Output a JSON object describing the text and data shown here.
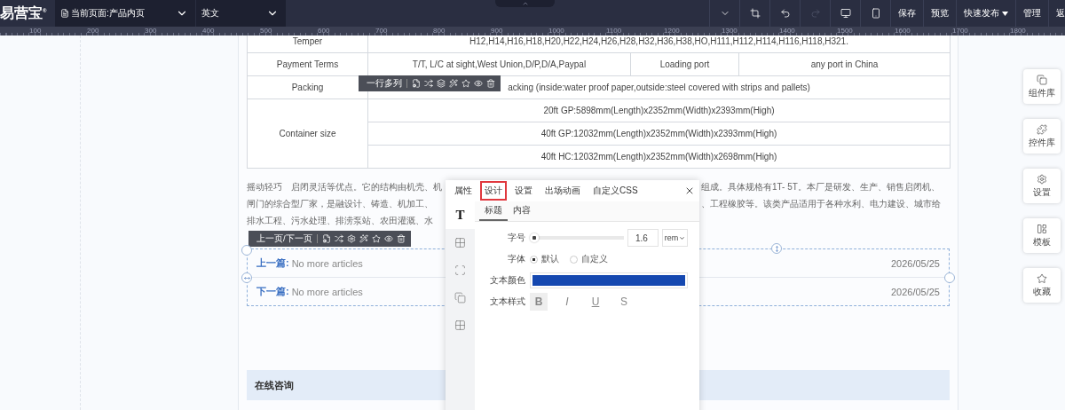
{
  "topbar": {
    "logo": "易营宝$^{®}$",
    "page_select": "当前页面:产品内页",
    "language_select": "英文",
    "tools": [
      {
        "disabled": false
      },
      {
        "disabled": false
      },
      {
        "disabled": false
      },
      {
        "disabled": true
      },
      {
        "disabled": false
      },
      {
        "disabled": false
      }
    ],
    "buttons": [
      {
        "label": "保存",
        "menu": false
      },
      {
        "label": "预览",
        "menu": false
      },
      {
        "label": "快速发布",
        "menu": true
      },
      {
        "label": "管理",
        "menu": false
      },
      {
        "label": "返",
        "menu": false
      }
    ]
  },
  "ruler": {
    "labels": [
      "100",
      "200",
      "300",
      "400",
      "500",
      "600",
      "700",
      "800",
      "900",
      "1000",
      "1100",
      "1200",
      "1300",
      "1400",
      "1500",
      "1600",
      "1700",
      "1800"
    ]
  },
  "spec_table": {
    "rows": [
      {
        "label": {
          "text": "Temper"
        },
        "cells": [
          {
            "text": "H12,H14,H16,H18,H20,H22,H24,H26,H28,H32,H36,H38,HO,H111,H112,H114,H116,H118,H321.",
            "colspan": 3
          }
        ]
      },
      {
        "label": {
          "text": "Payment Terms"
        },
        "cells": [
          {
            "text": "T/T, L/C at sight,West Union,D/P,D/A,Paypal"
          },
          {
            "text": "Loading port"
          },
          {
            "text": "any port in China"
          }
        ]
      },
      {
        "label": {
          "text": "Packing"
        },
        "cells": [
          {
            "text": "acking (inside:water proof paper,outside:steel covered with strips and pallets)",
            "colspan": 3
          }
        ]
      },
      {
        "label": {
          "text": "Container size",
          "rowspan": 3
        },
        "cells": [
          {
            "text": "20ft GP:5898mm(Length)x2352mm(Width)x2393mm(High)",
            "colspan": 3
          }
        ]
      },
      {
        "cells": [
          {
            "text": "40ft GP:12032mm(Length)x2352mm(Width)x2393mm(High)",
            "colspan": 3
          }
        ]
      },
      {
        "cells": [
          {
            "text": "40ft HC:12032mm(Length)x2352mm(Width)x2698mm(High)",
            "colspan": 3
          }
        ]
      }
    ]
  },
  "description": [
    {
      "left": "摇动轻巧　启闭灵活等优点。它的结构由机壳、机",
      "right": "组成。具体规格有1T- 5T。本厂是研发、生产、销售启闭机、"
    },
    {
      "left": "闸门的综合型厂家，是融设计、铸造、机加工、",
      "right": "、工程橡胶等。该类产品适用于各种水利、电力建设、城市给"
    },
    {
      "left": "排水工程、污水处理、排涝泵站、农田灌溉、水"
    }
  ],
  "element_toolbars": [
    {
      "label": "一行多列"
    },
    {
      "label": "上一页/下一页"
    }
  ],
  "pager": [
    {
      "label": "上一篇:",
      "title": "No more articles",
      "date": "2026/05/25"
    },
    {
      "label": "下一篇:",
      "title": "No more articles",
      "date": "2026/05/25"
    }
  ],
  "consult_bar": {
    "title": "在线咨询"
  },
  "style_panel": {
    "tabs": [
      {
        "label": "属性",
        "selected": false
      },
      {
        "label": "设计",
        "selected": true
      },
      {
        "label": "设置",
        "selected": false
      },
      {
        "label": "出场动画",
        "selected": false
      },
      {
        "label": "自定义CSS",
        "selected": false
      }
    ],
    "side_tabs": [
      {
        "kind": "glyph",
        "glyph": "T",
        "selected": true
      },
      {
        "kind": "icon",
        "selected": false
      },
      {
        "kind": "icon",
        "selected": false
      },
      {
        "kind": "icon",
        "selected": false
      },
      {
        "kind": "icon",
        "selected": false
      }
    ],
    "subtabs": [
      {
        "label": "标题",
        "selected": true
      },
      {
        "label": "内容",
        "selected": false
      }
    ],
    "font_size": {
      "label": "字号",
      "level": 0.05,
      "value": "1.6",
      "unit": "rem"
    },
    "font_family": {
      "label": "字体",
      "options": [
        {
          "label": "默认",
          "selected": true
        },
        {
          "label": "自定义",
          "selected": false
        }
      ]
    },
    "text_color": {
      "label": "文本颜色",
      "color": "#1548b0"
    },
    "text_style": {
      "label": "文本样式",
      "buttons": [
        {
          "glyph": "B",
          "on": true
        },
        {
          "glyph": "I",
          "on": false
        },
        {
          "glyph": "U",
          "on": false
        },
        {
          "glyph": "S",
          "on": false
        }
      ]
    }
  },
  "dock": [
    {
      "label": "组件库"
    },
    {
      "label": "控件库"
    },
    {
      "label": "设置"
    },
    {
      "label": "模板"
    },
    {
      "label": "收藏"
    }
  ]
}
